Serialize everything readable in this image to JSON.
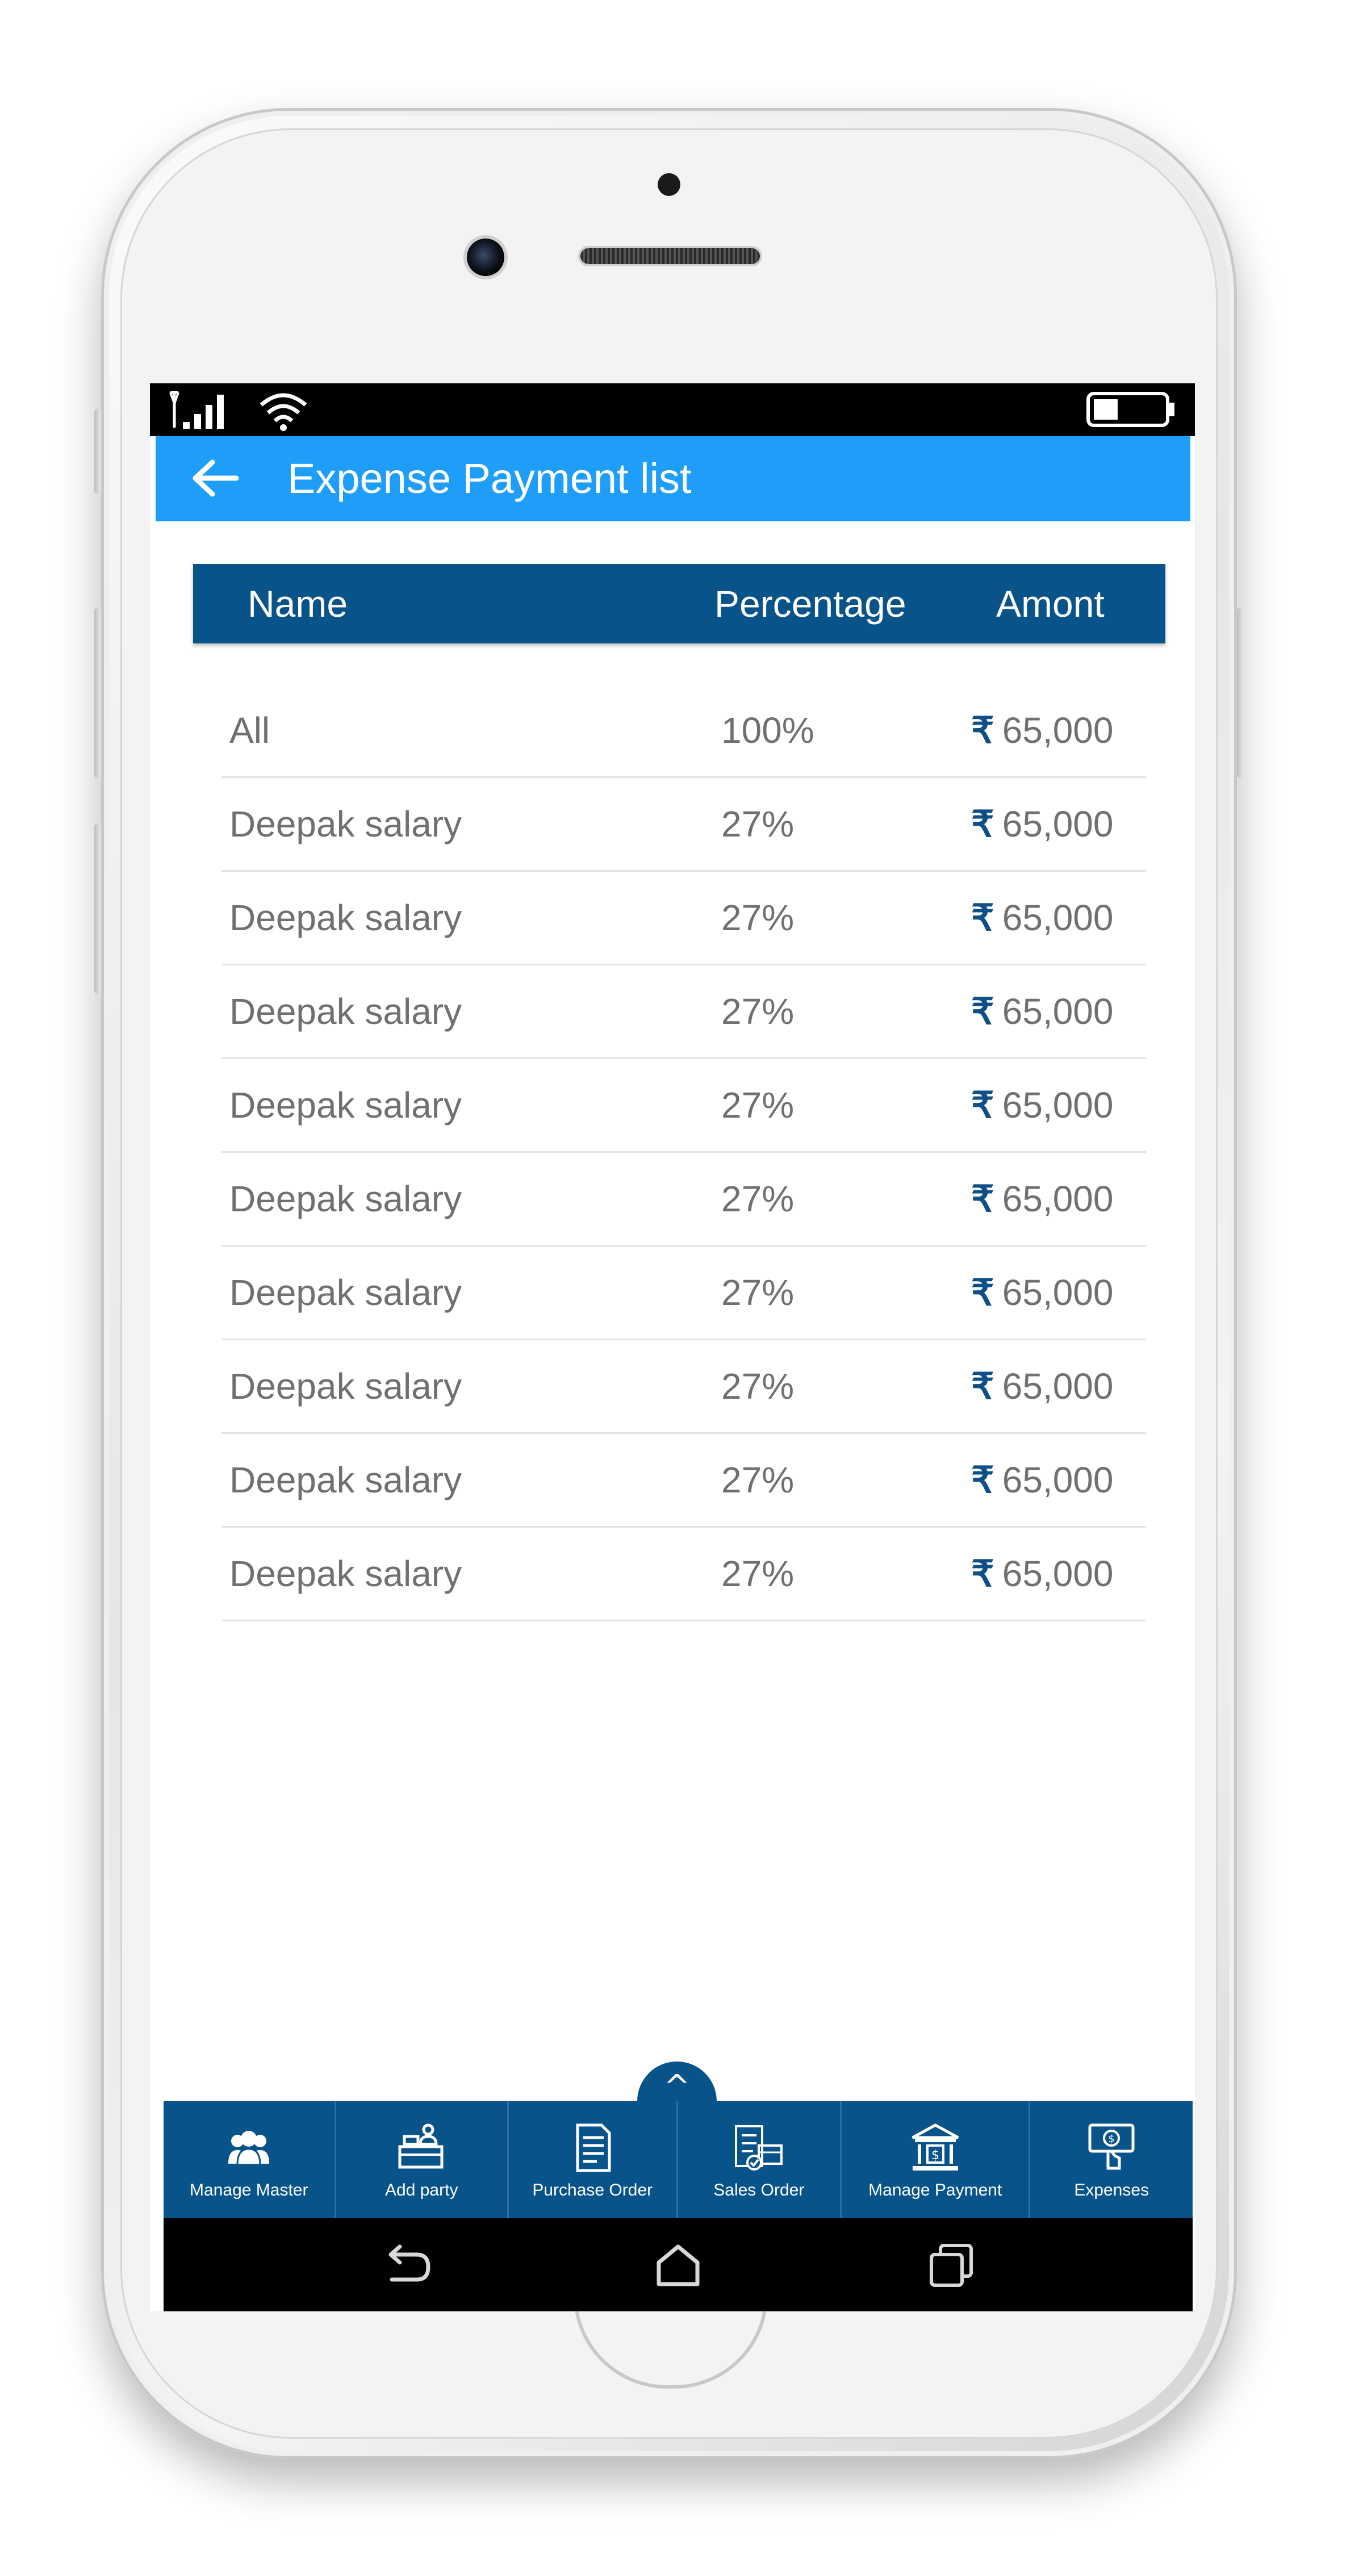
{
  "app_bar": {
    "title": "Expense Payment list"
  },
  "table": {
    "headers": {
      "name": "Name",
      "percentage": "Percentage",
      "amount": "Amont"
    },
    "rows": [
      {
        "name": "All",
        "percentage": "100%",
        "currency": "₹",
        "amount": "65,000"
      },
      {
        "name": "Deepak salary",
        "percentage": "27%",
        "currency": "₹",
        "amount": "65,000"
      },
      {
        "name": "Deepak salary",
        "percentage": "27%",
        "currency": "₹",
        "amount": "65,000"
      },
      {
        "name": "Deepak salary",
        "percentage": "27%",
        "currency": "₹",
        "amount": "65,000"
      },
      {
        "name": "Deepak salary",
        "percentage": "27%",
        "currency": "₹",
        "amount": "65,000"
      },
      {
        "name": "Deepak salary",
        "percentage": "27%",
        "currency": "₹",
        "amount": "65,000"
      },
      {
        "name": "Deepak salary",
        "percentage": "27%",
        "currency": "₹",
        "amount": "65,000"
      },
      {
        "name": "Deepak salary",
        "percentage": "27%",
        "currency": "₹",
        "amount": "65,000"
      },
      {
        "name": "Deepak salary",
        "percentage": "27%",
        "currency": "₹",
        "amount": "65,000"
      },
      {
        "name": "Deepak salary",
        "percentage": "27%",
        "currency": "₹",
        "amount": "65,000"
      }
    ]
  },
  "bottom_nav": {
    "expand_glyph": "^",
    "items": [
      {
        "label": "Manage Master",
        "icon": "users-icon"
      },
      {
        "label": "Add party",
        "icon": "party-desk-icon"
      },
      {
        "label": "Purchase Order",
        "icon": "document-list-icon"
      },
      {
        "label": "Sales Order",
        "icon": "sales-checklist-icon"
      },
      {
        "label": "Manage Payment",
        "icon": "bank-icon"
      },
      {
        "label": "Expenses",
        "icon": "cash-hand-icon"
      }
    ]
  },
  "colors": {
    "app_bar": "#1e9ef9",
    "header_blue": "#08538a",
    "text_gray": "#707070"
  }
}
